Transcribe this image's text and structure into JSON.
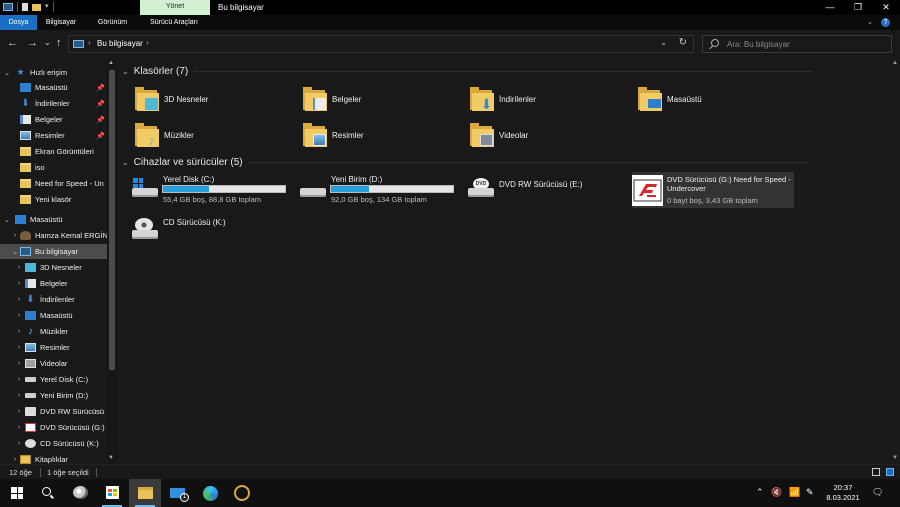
{
  "window": {
    "title": "Bu bilgisayar",
    "manage_tab": "Yönet",
    "controls": {
      "minimize": "—",
      "maximize": "❐",
      "close": "✕"
    }
  },
  "ribbon": {
    "tabs": [
      {
        "label": "Dosya",
        "active": true
      },
      {
        "label": "Bilgisayar",
        "active": false
      },
      {
        "label": "Görünüm",
        "active": false
      },
      {
        "label": "Sürücü Araçları",
        "active": false
      }
    ],
    "expand_icon": "⌄",
    "help_icon": "?"
  },
  "address": {
    "back": "←",
    "forward": "→",
    "recent": "⌄",
    "up": "↑",
    "path": "Bu bilgisayar",
    "separator": "›",
    "dropdown": "⌄",
    "refresh": "↻"
  },
  "search": {
    "placeholder": "Ara: Bu bilgisayar"
  },
  "nav": {
    "quick_access": {
      "label": "Hızlı erişim",
      "items": [
        {
          "label": "Masaüstü",
          "pinned": true,
          "icon": "desktop-icon"
        },
        {
          "label": "İndirilenler",
          "pinned": true,
          "icon": "download-icon"
        },
        {
          "label": "Belgeler",
          "pinned": true,
          "icon": "documents-icon"
        },
        {
          "label": "Resimler",
          "pinned": true,
          "icon": "pictures-icon"
        },
        {
          "label": "Ekran Görüntüleri",
          "pinned": false,
          "icon": "folder-icon"
        },
        {
          "label": "iso",
          "pinned": false,
          "icon": "folder-icon"
        },
        {
          "label": "Need for Speed - Un",
          "pinned": false,
          "icon": "folder-icon"
        },
        {
          "label": "Yeni klasör",
          "pinned": false,
          "icon": "folder-icon"
        }
      ]
    },
    "desktop": "Masaüstü",
    "user": "Hamza Kemal ERGİN",
    "this_pc": {
      "label": "Bu bilgisayar",
      "items": [
        {
          "label": "3D Nesneler",
          "icon": "3d-objects-icon"
        },
        {
          "label": "Belgeler",
          "icon": "documents-icon"
        },
        {
          "label": "İndirilenler",
          "icon": "download-icon"
        },
        {
          "label": "Masaüstü",
          "icon": "desktop-icon"
        },
        {
          "label": "Müzikler",
          "icon": "music-icon"
        },
        {
          "label": "Resimler",
          "icon": "pictures-icon"
        },
        {
          "label": "Videolar",
          "icon": "videos-icon"
        },
        {
          "label": "Yerel Disk (C:)",
          "icon": "drive-icon"
        },
        {
          "label": "Yeni Birim (D:)",
          "icon": "drive-icon"
        },
        {
          "label": "DVD RW Sürücüsü",
          "icon": "dvd-icon"
        },
        {
          "label": "DVD Sürücüsü (G:)",
          "icon": "nfs-icon"
        },
        {
          "label": "CD Sürücüsü (K:)",
          "icon": "cd-icon"
        }
      ]
    },
    "libraries": "Kitaplıklar"
  },
  "content": {
    "folders_header": "Klasörler (7)",
    "folders": [
      {
        "label": "3D Nesneler",
        "icon": "3d-objects-folder-icon"
      },
      {
        "label": "Belgeler",
        "icon": "documents-folder-icon"
      },
      {
        "label": "İndirilenler",
        "icon": "downloads-folder-icon"
      },
      {
        "label": "Masaüstü",
        "icon": "desktop-folder-icon"
      },
      {
        "label": "Müzikler",
        "icon": "music-folder-icon"
      },
      {
        "label": "Resimler",
        "icon": "pictures-folder-icon"
      },
      {
        "label": "Videolar",
        "icon": "videos-folder-icon"
      }
    ],
    "devices_header": "Cihazlar ve sürücüler (5)",
    "drives": [
      {
        "name": "Yerel Disk (C:)",
        "free": "55,4 GB boş, 88,8 GB toplam",
        "used_fraction": 0.376,
        "icon": "windows-drive-icon"
      },
      {
        "name": "Yeni Birim (D:)",
        "free": "92,0 GB boş, 134 GB toplam",
        "used_fraction": 0.313,
        "icon": "hard-drive-icon"
      },
      {
        "name": "DVD RW Sürücüsü (E:)",
        "icon": "dvd-drive-icon",
        "dvd_label": "DVD"
      },
      {
        "name": "DVD Sürücüsü (G:) Need for Speed - Undercover",
        "free": "0 bayt boş, 3,43 GB toplam",
        "icon": "nfs-disc-icon"
      },
      {
        "name": "CD Sürücüsü (K:)",
        "icon": "cd-drive-icon"
      }
    ]
  },
  "status": {
    "items": "12 öğe",
    "selected": "1 öğe seçildi"
  },
  "taskbar": {
    "clock_time": "20:37",
    "clock_date": "8.03.2021",
    "mail_badge": "1",
    "tray_chevron": "⌃"
  },
  "colors": {
    "accent": "#1a6fc4",
    "drive_bar": "#26a0da",
    "manage_tab": "#d2f0d0"
  }
}
